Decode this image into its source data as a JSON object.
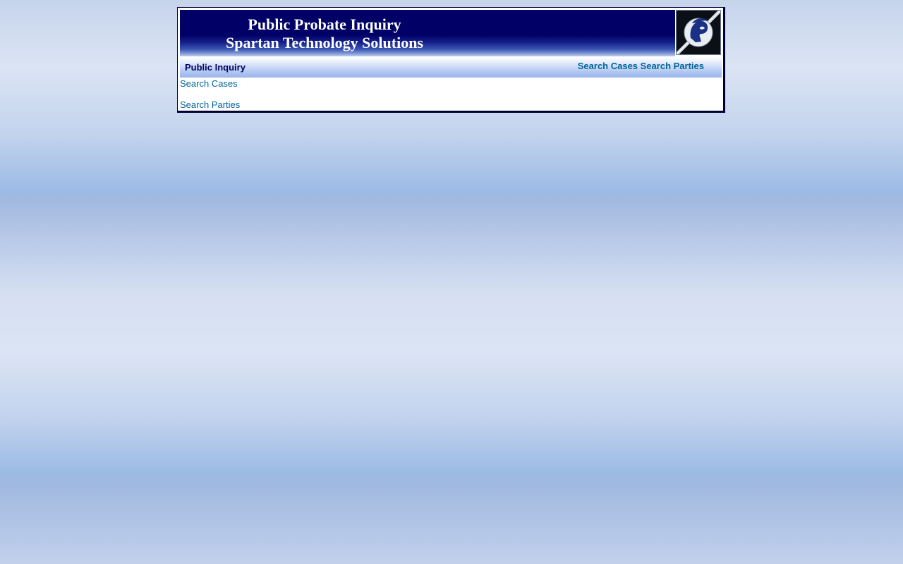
{
  "banner": {
    "title_line1": "Public Probate Inquiry",
    "title_line2": "Spartan Technology Solutions",
    "logo_icon": "spartan-helmet-icon"
  },
  "navbar": {
    "title": "Public Inquiry",
    "links": [
      {
        "label": "Search Cases"
      },
      {
        "label": "Search Parties"
      }
    ]
  },
  "content": {
    "links": [
      {
        "label": "Search Cases"
      },
      {
        "label": "Search Parties"
      }
    ]
  },
  "colors": {
    "banner_navy": "#000066",
    "link_teal": "#006699",
    "nav_gradient_bottom": "#9bb8ec"
  }
}
